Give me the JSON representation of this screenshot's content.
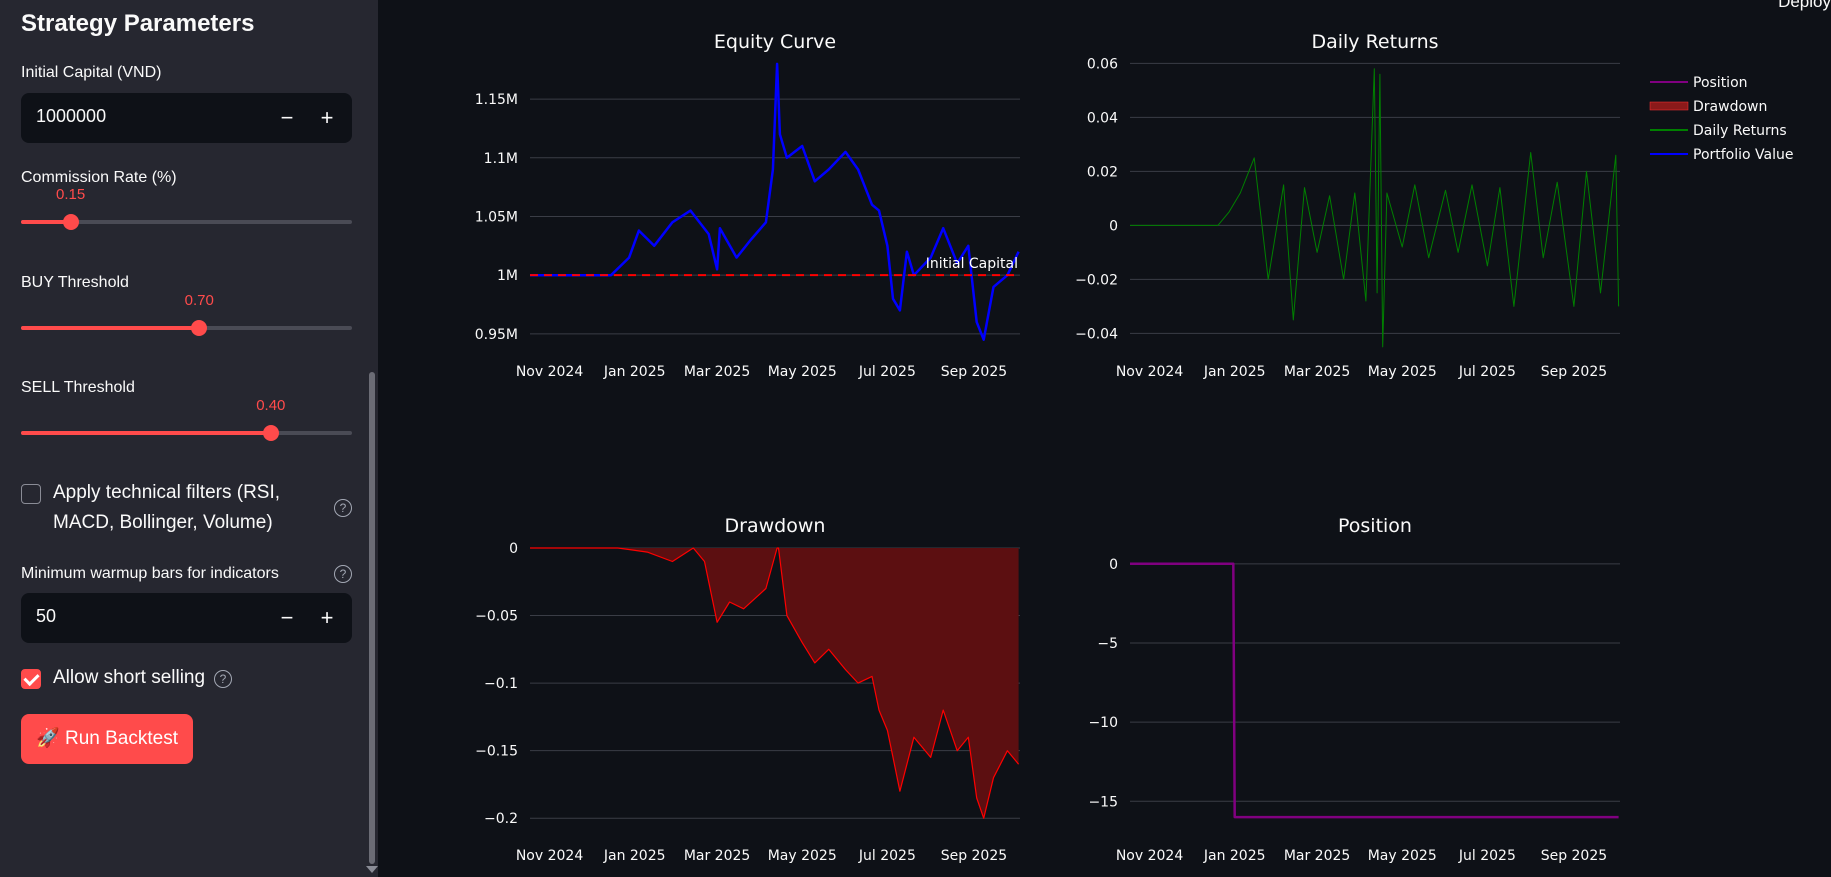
{
  "header": {
    "deploy_label": "Deploy"
  },
  "sidebar": {
    "title": "Strategy Parameters",
    "initial_capital": {
      "label": "Initial Capital (VND)",
      "value": "1000000",
      "minus": "−",
      "plus": "+"
    },
    "commission": {
      "label": "Commission Rate (%)",
      "value_text": "0.15",
      "value": 0.15,
      "min": 0,
      "max": 1
    },
    "buy_threshold": {
      "label": "BUY Threshold",
      "value_text": "0.70",
      "value": 0.7,
      "min": 0,
      "max": 1.3
    },
    "sell_threshold": {
      "label": "SELL Threshold",
      "value_text": "0.40",
      "value": 0.4,
      "min": 0,
      "max": 0.53
    },
    "tech_filters": {
      "label_line1": "Apply technical filters (RSI,",
      "label_line2": "MACD, Bollinger, Volume)",
      "checked": false,
      "help": "?"
    },
    "warmup": {
      "label": "Minimum warmup bars for indicators",
      "value": "50",
      "minus": "−",
      "plus": "+",
      "help": "?"
    },
    "short_selling": {
      "label": "Allow short selling",
      "checked": true,
      "help": "?"
    },
    "run_button": {
      "label": "Run Backtest",
      "icon": "🚀"
    }
  },
  "colors": {
    "accent": "#ff4b4b",
    "sidebar_bg": "#262730",
    "main_bg": "#0e1117",
    "portfolio": "#0000ff",
    "returns": "#008000",
    "drawdown": "#ff0000",
    "drawdown_fill": "#5c0f11",
    "position": "#800080"
  },
  "chart_data": [
    {
      "type": "line",
      "title": "Equity Curve",
      "x_tick_labels": [
        "Nov 2024",
        "Jan 2025",
        "Mar 2025",
        "May 2025",
        "Jul 2025",
        "Sep 2025"
      ],
      "y_tick_labels": [
        "0.95M",
        "1M",
        "1.05M",
        "1.1M",
        "1.15M"
      ],
      "y_ticks": [
        950000,
        1000000,
        1050000,
        1100000,
        1150000
      ],
      "ylim": [
        932000,
        1185000
      ],
      "reference_line": {
        "value": 1000000,
        "label": "Initial Capital"
      },
      "series": [
        {
          "name": "Portfolio Value",
          "x": [
            "2024-10-18",
            "2024-12-15",
            "2024-12-28",
            "2025-01-04",
            "2025-01-15",
            "2025-01-28",
            "2025-02-10",
            "2025-02-23",
            "2025-03-01",
            "2025-03-03",
            "2025-03-15",
            "2025-03-25",
            "2025-04-05",
            "2025-04-10",
            "2025-04-13",
            "2025-04-15",
            "2025-04-20",
            "2025-05-01",
            "2025-05-10",
            "2025-05-20",
            "2025-06-01",
            "2025-06-10",
            "2025-06-20",
            "2025-06-25",
            "2025-07-01",
            "2025-07-05",
            "2025-07-10",
            "2025-07-15",
            "2025-07-20",
            "2025-08-01",
            "2025-08-10",
            "2025-08-20",
            "2025-08-28",
            "2025-09-03",
            "2025-09-08",
            "2025-09-15",
            "2025-09-25",
            "2025-10-03"
          ],
          "values": [
            1000000,
            1000000,
            1015000,
            1038000,
            1025000,
            1045000,
            1055000,
            1035000,
            1005000,
            1040000,
            1015000,
            1030000,
            1045000,
            1090000,
            1180000,
            1120000,
            1100000,
            1110000,
            1080000,
            1090000,
            1105000,
            1090000,
            1060000,
            1055000,
            1025000,
            980000,
            970000,
            1020000,
            1000000,
            1015000,
            1040000,
            1010000,
            1025000,
            960000,
            945000,
            990000,
            1000000,
            1020000
          ]
        }
      ]
    },
    {
      "type": "line",
      "title": "Daily Returns",
      "x_tick_labels": [
        "Nov 2024",
        "Jan 2025",
        "Mar 2025",
        "May 2025",
        "Jul 2025",
        "Sep 2025"
      ],
      "y_tick_labels": [
        "−0.04",
        "−0.02",
        "0",
        "0.02",
        "0.04",
        "0.06"
      ],
      "y_ticks": [
        -0.04,
        -0.02,
        0,
        0.02,
        0.04,
        0.06
      ],
      "ylim": [
        -0.048,
        0.062
      ],
      "series": [
        {
          "name": "Daily Returns",
          "x": [
            "2024-10-18",
            "2024-12-20",
            "2024-12-28",
            "2025-01-05",
            "2025-01-15",
            "2025-01-25",
            "2025-02-05",
            "2025-02-12",
            "2025-02-20",
            "2025-03-01",
            "2025-03-10",
            "2025-03-20",
            "2025-03-28",
            "2025-04-05",
            "2025-04-11",
            "2025-04-13",
            "2025-04-15",
            "2025-04-17",
            "2025-04-20",
            "2025-05-01",
            "2025-05-10",
            "2025-05-20",
            "2025-06-01",
            "2025-06-10",
            "2025-06-20",
            "2025-07-01",
            "2025-07-10",
            "2025-07-20",
            "2025-08-01",
            "2025-08-10",
            "2025-08-20",
            "2025-09-01",
            "2025-09-10",
            "2025-09-20",
            "2025-10-01",
            "2025-10-03"
          ],
          "values": [
            0,
            0,
            0.005,
            0.012,
            0.025,
            -0.02,
            0.015,
            -0.035,
            0.014,
            -0.01,
            0.011,
            -0.02,
            0.012,
            -0.028,
            0.058,
            -0.025,
            0.056,
            -0.045,
            0.012,
            -0.008,
            0.015,
            -0.012,
            0.013,
            -0.01,
            0.015,
            -0.015,
            0.014,
            -0.03,
            0.027,
            -0.012,
            0.016,
            -0.03,
            0.02,
            -0.025,
            0.026,
            -0.03
          ]
        }
      ]
    },
    {
      "type": "area",
      "title": "Drawdown",
      "x_tick_labels": [
        "Nov 2024",
        "Jan 2025",
        "Mar 2025",
        "May 2025",
        "Jul 2025",
        "Sep 2025"
      ],
      "y_tick_labels": [
        "−0.2",
        "−0.15",
        "−0.1",
        "−0.05",
        "0"
      ],
      "y_ticks": [
        -0.2,
        -0.15,
        -0.1,
        -0.05,
        0
      ],
      "ylim": [
        -0.205,
        0
      ],
      "series": [
        {
          "name": "Drawdown",
          "x": [
            "2024-10-18",
            "2024-12-20",
            "2025-01-10",
            "2025-01-28",
            "2025-02-12",
            "2025-02-20",
            "2025-03-01",
            "2025-03-10",
            "2025-03-20",
            "2025-04-05",
            "2025-04-13",
            "2025-04-14",
            "2025-04-20",
            "2025-05-01",
            "2025-05-10",
            "2025-05-20",
            "2025-06-01",
            "2025-06-10",
            "2025-06-20",
            "2025-06-25",
            "2025-07-01",
            "2025-07-05",
            "2025-07-10",
            "2025-07-15",
            "2025-07-20",
            "2025-08-01",
            "2025-08-10",
            "2025-08-20",
            "2025-08-28",
            "2025-09-03",
            "2025-09-08",
            "2025-09-15",
            "2025-09-25",
            "2025-10-03"
          ],
          "values": [
            0,
            0,
            -0.003,
            -0.01,
            0,
            -0.01,
            -0.055,
            -0.04,
            -0.045,
            -0.03,
            0,
            0,
            -0.05,
            -0.07,
            -0.085,
            -0.075,
            -0.09,
            -0.1,
            -0.095,
            -0.12,
            -0.135,
            -0.155,
            -0.18,
            -0.16,
            -0.14,
            -0.155,
            -0.12,
            -0.15,
            -0.14,
            -0.185,
            -0.2,
            -0.17,
            -0.15,
            -0.16
          ]
        }
      ]
    },
    {
      "type": "line",
      "title": "Position",
      "x_tick_labels": [
        "Nov 2024",
        "Jan 2025",
        "Mar 2025",
        "May 2025",
        "Jul 2025",
        "Sep 2025"
      ],
      "y_tick_labels": [
        "−15",
        "−10",
        "−5",
        "0"
      ],
      "y_ticks": [
        -15,
        -10,
        -5,
        0
      ],
      "ylim": [
        -16.5,
        1
      ],
      "series": [
        {
          "name": "Position",
          "x": [
            "2024-10-18",
            "2024-12-31",
            "2025-01-01",
            "2025-10-03"
          ],
          "values": [
            0,
            0,
            -16,
            -16
          ]
        }
      ]
    }
  ],
  "legend": {
    "placement": "right",
    "items": [
      {
        "name": "Position",
        "color": "#800080",
        "kind": "line"
      },
      {
        "name": "Drawdown",
        "color": "#8b1a1a",
        "kind": "patch"
      },
      {
        "name": "Daily Returns",
        "color": "#008000",
        "kind": "line"
      },
      {
        "name": "Portfolio Value",
        "color": "#0000ff",
        "kind": "line"
      }
    ]
  }
}
